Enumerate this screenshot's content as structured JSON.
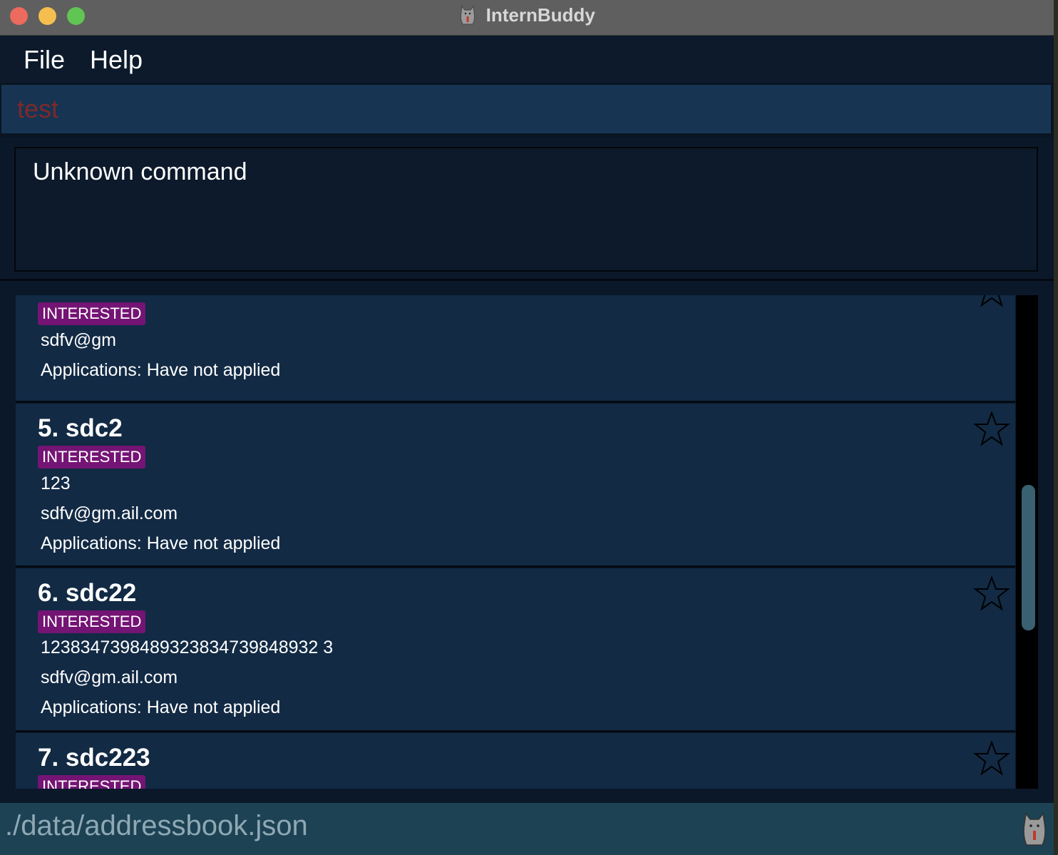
{
  "window": {
    "title": "InternBuddy"
  },
  "menu": {
    "file": "File",
    "help": "Help"
  },
  "command": {
    "value": "test"
  },
  "result": {
    "text": "Unknown command"
  },
  "list": {
    "cards": [
      {
        "name": "",
        "tag": "INTERESTED",
        "email": "sdfv@gm",
        "applications": "Applications: Have not applied"
      },
      {
        "name": "5. sdc2",
        "tag": "INTERESTED",
        "phone": "123",
        "email": "sdfv@gm.ail.com",
        "applications": "Applications: Have not applied"
      },
      {
        "name": "6. sdc22",
        "tag": "INTERESTED",
        "phone": "1238347398489323834739848932 3",
        "email": "sdfv@gm.ail.com",
        "applications": "Applications: Have not applied"
      },
      {
        "name": "7. sdc223",
        "tag": "INTERESTED"
      }
    ]
  },
  "status": {
    "path": "./data/addressbook.json"
  },
  "colors": {
    "tag": "#741474",
    "card": "#122a44",
    "status": "#1c4254"
  }
}
